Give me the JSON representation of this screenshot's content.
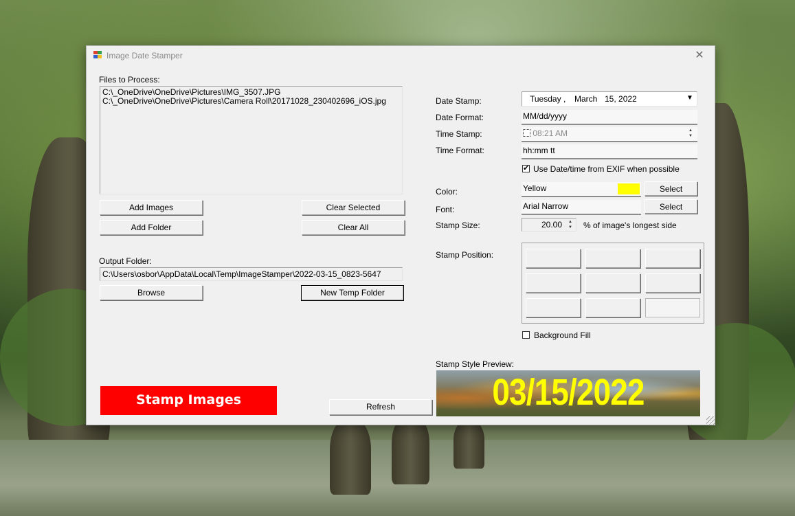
{
  "window": {
    "title": "Image Date Stamper"
  },
  "left": {
    "files_label": "Files to Process:",
    "files": [
      "C:\\_OneDrive\\OneDrive\\Pictures\\IMG_3507.JPG",
      "C:\\_OneDrive\\OneDrive\\Pictures\\Camera Roll\\20171028_230402696_iOS.jpg"
    ],
    "add_images": "Add Images",
    "clear_selected": "Clear Selected",
    "add_folder": "Add Folder",
    "clear_all": "Clear All",
    "output_label": "Output Folder:",
    "output_path": "C:\\Users\\osbor\\AppData\\Local\\Temp\\ImageStamper\\2022-03-15_0823-5647",
    "browse": "Browse",
    "new_temp_folder": "New Temp Folder",
    "stamp_images": "Stamp Images",
    "refresh": "Refresh"
  },
  "right": {
    "date_stamp_label": "Date Stamp:",
    "date_day": "Tuesday",
    "date_sep": ",",
    "date_month": "March",
    "date_rest": "15, 2022",
    "date_format_label": "Date Format:",
    "date_format": "MM/dd/yyyy",
    "time_stamp_label": "Time Stamp:",
    "time_value": "08:21 AM",
    "time_format_label": "Time Format:",
    "time_format": "hh:mm tt",
    "exif_label": "Use Date/time from EXIF when possible",
    "color_label": "Color:",
    "color_name": "Yellow",
    "color_swatch": "#ffff00",
    "select1": "Select",
    "font_label": "Font:",
    "font_name": "Arial Narrow",
    "select2": "Select",
    "stamp_size_label": "Stamp Size:",
    "stamp_size": "20.00",
    "stamp_size_suffix": "% of image's longest side",
    "position_label": "Stamp Position:",
    "background_fill": "Background Fill",
    "preview_label": "Stamp Style Preview:",
    "preview_text": "03/15/2022"
  }
}
